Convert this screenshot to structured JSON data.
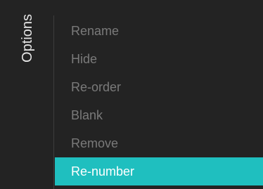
{
  "panel": {
    "title": "Options",
    "accent_color": "#1fbfbf",
    "items": [
      {
        "label": "Rename",
        "selected": false
      },
      {
        "label": "Hide",
        "selected": false
      },
      {
        "label": "Re-order",
        "selected": false
      },
      {
        "label": "Blank",
        "selected": false
      },
      {
        "label": "Remove",
        "selected": false
      },
      {
        "label": "Re-number",
        "selected": true
      }
    ]
  }
}
